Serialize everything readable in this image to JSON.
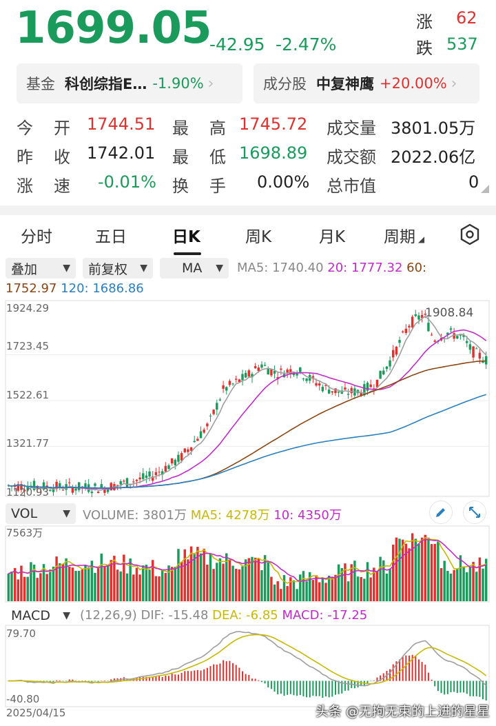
{
  "quote": {
    "price": "1699.05",
    "change": "-42.95",
    "change_pct": "-2.47%",
    "up_label": "涨",
    "up_count": "62",
    "down_label": "跌",
    "down_count": "537"
  },
  "related": [
    {
      "label": "基金",
      "name": "科创综指E…",
      "change": "-1.90%"
    },
    {
      "label": "成分股",
      "name": "中复神鹰",
      "change": "+20.00%"
    }
  ],
  "stats": [
    {
      "label": "今开",
      "value": "1744.51"
    },
    {
      "label": "最高",
      "value": "1745.72"
    },
    {
      "label": "成交量",
      "value": "3801.05万"
    },
    {
      "label": "昨收",
      "value": "1742.01"
    },
    {
      "label": "最低",
      "value": "1698.89"
    },
    {
      "label": "成交额",
      "value": "2022.06亿"
    },
    {
      "label": "涨速",
      "value": "-0.01%"
    },
    {
      "label": "换手",
      "value": "0.00%"
    },
    {
      "label": "总市值",
      "value": "0"
    }
  ],
  "tabs": [
    "分时",
    "五日",
    "日K",
    "周K",
    "月K",
    "周期"
  ],
  "controls": {
    "overlay": "叠加",
    "adjust": "前复权",
    "indicator": "MA",
    "ma_text": {
      "ma5": "MA5: 1740.40",
      "ma20": "20: 1777.32",
      "ma60_a": "60:",
      "ma60_b": "1752.97",
      "ma120": "120: 1686.86"
    }
  },
  "kchart": {
    "y_ticks": [
      "1924.29",
      "1723.45",
      "1522.61",
      "1321.77",
      "1120.93"
    ],
    "max_label": "1908.84"
  },
  "volume": {
    "selector": "VOL",
    "volume_text": "VOLUME: 3801万",
    "ma5_text": "MA5: 4278万",
    "ma10_text": "10: 4350万",
    "y_max": "7563万"
  },
  "macd": {
    "selector": "MACD",
    "params": "(12,26,9)",
    "dif_text": "DIF: -15.48",
    "dea_text": "DEA: -6.85",
    "macd_text": "MACD: -17.25",
    "y_max": "79.70",
    "y_min": "-40.80",
    "start_date": "2025/04/15"
  },
  "watermark": "头条 @无拘无束的上进的星星",
  "colors": {
    "up": "#e0312f",
    "down": "#1a9b5b",
    "ma5": "#9e9e9e",
    "ma20": "#c12bc9",
    "ma60": "#8b4513",
    "ma120": "#2a7fc1",
    "dea": "#c9b800"
  }
}
